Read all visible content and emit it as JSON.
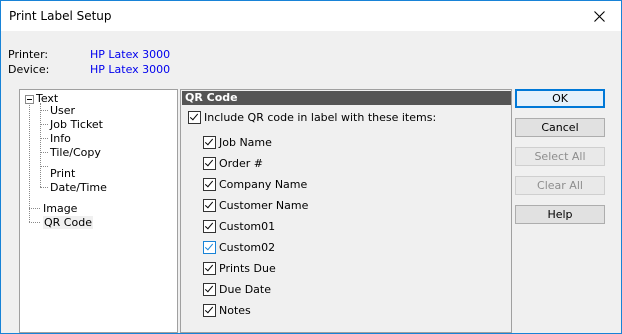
{
  "window": {
    "title": "Print Label Setup"
  },
  "info": {
    "printer_label": "Printer:",
    "printer_value": "HP Latex 3000",
    "device_label": "Device:",
    "device_value": "HP Latex 3000"
  },
  "tree": {
    "text": "Text",
    "user": "User",
    "job_ticket": "Job Ticket",
    "info": "Info",
    "tile_copy": "Tile/Copy",
    "print": "Print",
    "date_time": "Date/Time",
    "image": "Image",
    "qr_code": "QR Code"
  },
  "panel": {
    "title": "QR Code",
    "include_label": "Include QR code in label with these items:",
    "items": [
      "Job Name",
      "Order #",
      "Company Name",
      "Customer Name",
      "Custom01",
      "Custom02",
      "Prints Due",
      "Due Date",
      "Notes"
    ]
  },
  "buttons": {
    "ok": "OK",
    "cancel": "Cancel",
    "select_all": "Select All",
    "clear_all": "Clear All",
    "help": "Help"
  },
  "colors": {
    "accent": "#0078d7",
    "link_blue": "#0000ee",
    "header_bg": "#555555"
  },
  "icons": {
    "close": "close-icon",
    "expander": "tree-collapse-icon"
  }
}
